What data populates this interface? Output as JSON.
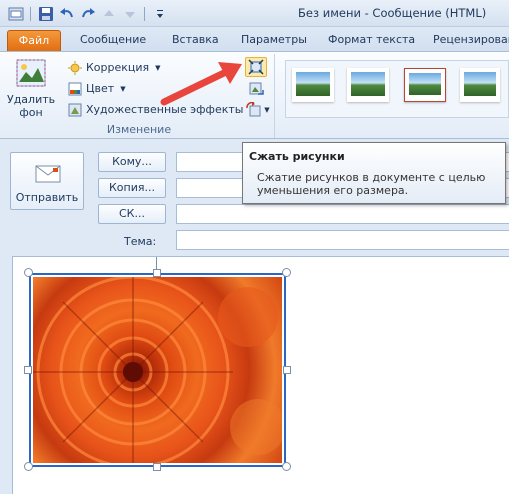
{
  "window": {
    "title": "Без имени  -  Сообщение (HTML)"
  },
  "quick_access": [
    {
      "icon": "outlook-icon"
    },
    {
      "icon": "save-icon"
    },
    {
      "icon": "undo-icon"
    },
    {
      "icon": "redo-icon"
    },
    {
      "icon": "up-arrow-icon"
    },
    {
      "icon": "down-arrow-icon"
    },
    {
      "icon": "customize-qat-icon"
    }
  ],
  "tabs": [
    {
      "label": "Файл",
      "active": true
    },
    {
      "label": "Сообщение"
    },
    {
      "label": "Вставка"
    },
    {
      "label": "Параметры"
    },
    {
      "label": "Формат текста"
    },
    {
      "label": "Рецензирован"
    }
  ],
  "ribbon": {
    "remove_background_label": "Удалить фон",
    "correction_label": "Коррекция",
    "color_label": "Цвет",
    "artistic_effects_label": "Художественные эффекты",
    "group_label": "Изменение",
    "icon_buttons": [
      {
        "icon": "compress-pictures-icon",
        "highlighted": true
      },
      {
        "icon": "change-picture-icon"
      },
      {
        "icon": "reset-picture-icon"
      }
    ],
    "picture_styles_count": 5
  },
  "tooltip": {
    "title": "Сжать рисунки",
    "body": "Сжатие рисунков в документе с целью уменьшения его размера."
  },
  "compose": {
    "send_label": "Отправить",
    "to_label": "Кому...",
    "cc_label": "Копия...",
    "bcc_label": "СК...",
    "subject_label": "Тема:",
    "to_value": "",
    "cc_value": "",
    "bcc_value": "",
    "subject_value": ""
  },
  "colors": {
    "file_tab": "#e26d10",
    "accent_arrow": "#e8453c",
    "selection": "#2a66c4"
  }
}
